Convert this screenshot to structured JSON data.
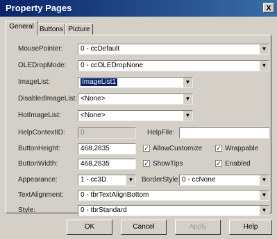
{
  "window": {
    "title": "Property Pages",
    "close_glyph": "X"
  },
  "tabs": [
    {
      "label": "General"
    },
    {
      "label": "Buttons"
    },
    {
      "label": "Picture"
    }
  ],
  "fields": {
    "mouse_pointer": {
      "label": "MousePointer:",
      "value": "0 - ccDefault"
    },
    "ole_drop_mode": {
      "label": "OLEDropMode:",
      "value": "0 - ccOLEDropNone"
    },
    "image_list": {
      "label": "ImageList:",
      "value": "ImageList1"
    },
    "disabled_image_list": {
      "label": "DisabledImageList:",
      "value": "<None>"
    },
    "hot_image_list": {
      "label": "HotImageList:",
      "value": "<None>"
    },
    "help_context_id": {
      "label": "HelpContextID:",
      "value": "0"
    },
    "help_file": {
      "label": "HelpFile:",
      "value": ""
    },
    "button_height": {
      "label": "ButtonHeight:",
      "value": "468,2835"
    },
    "button_width": {
      "label": "ButtonWidth:",
      "value": "468,2835"
    },
    "appearance": {
      "label": "Appearance:",
      "value": "1 - cc3D"
    },
    "border_style": {
      "label": "BorderStyle:",
      "value": "0 - ccNone"
    },
    "text_alignment": {
      "label": "TextAlignment:",
      "value": "0 - tbrTextAlignBottom"
    },
    "style": {
      "label": "Style:",
      "value": "0 - tbrStandard"
    }
  },
  "checkboxes": {
    "allow_customize": {
      "label": "AllowCustomize",
      "checked": true
    },
    "wrappable": {
      "label": "Wrappable",
      "checked": true
    },
    "show_tips": {
      "label": "ShowTips",
      "checked": true
    },
    "enabled": {
      "label": "Enabled",
      "checked": true
    }
  },
  "buttons": {
    "ok": "OK",
    "cancel": "Cancel",
    "apply": "Apply",
    "help": "Help"
  },
  "glyphs": {
    "dropdown": "▼",
    "check": "✓"
  }
}
